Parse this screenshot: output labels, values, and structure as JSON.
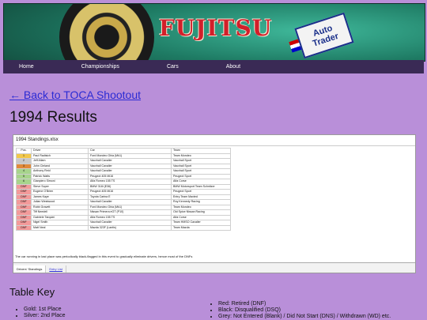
{
  "banner": {
    "brand": "FUJITSU",
    "sponsor_line1": "Auto",
    "sponsor_line2": "Trader"
  },
  "nav": {
    "items": [
      "Home",
      "Championships",
      "Cars",
      "About"
    ]
  },
  "back_link": "← Back to TOCA Shootout",
  "page_title": "1994 Results",
  "sheet": {
    "filename": "1994 Standings.xlsx",
    "headers": [
      "Pos.",
      "Driver",
      "Car",
      "Team"
    ],
    "rows": [
      {
        "pos": "1",
        "driver": "Paul Radisich",
        "car": "Ford Mondeo Ghia (Mk1)",
        "team": "Team Mondeo",
        "cls": "gold"
      },
      {
        "pos": "2",
        "driver": "Jeff Allam",
        "car": "Vauxhall Cavalier",
        "team": "Vauxhall Sport",
        "cls": "silver"
      },
      {
        "pos": "3",
        "driver": "John Cleland",
        "car": "Vauxhall Cavalier",
        "team": "Vauxhall Sport",
        "cls": "bronze"
      },
      {
        "pos": "4",
        "driver": "Anthony Reid",
        "car": "Vauxhall Cavalier",
        "team": "Vauxhall Sport",
        "cls": "green"
      },
      {
        "pos": "5",
        "driver": "Patrick Watts",
        "car": "Peugeot 405 Mi16",
        "team": "Peugeot Sport",
        "cls": "green"
      },
      {
        "pos": "6",
        "driver": "Gianpiero Simoni",
        "car": "Alfa Romeo 155 TS",
        "team": "Alfa Corse",
        "cls": "green"
      },
      {
        "pos": "DNF",
        "driver": "Steve Soper",
        "car": "BMW 318i (E36)",
        "team": "BMW Motorsport Team Schnitzer",
        "cls": "red"
      },
      {
        "pos": "DNF",
        "driver": "Eugene O'Brien",
        "car": "Peugeot 405 Mi16",
        "team": "Peugeot Sport",
        "cls": "red"
      },
      {
        "pos": "DNF",
        "driver": "James Kaye",
        "car": "Toyota Carina E",
        "team": "Entry Team Maxted",
        "cls": "red"
      },
      {
        "pos": "DNF",
        "driver": "Julian Westwood",
        "car": "Vauxhall Cavalier",
        "team": "Roy Kennedy Racing",
        "cls": "red"
      },
      {
        "pos": "DNF",
        "driver": "Robb Gravett",
        "car": "Ford Mondeo Ghia (Mk1)",
        "team": "Team Mondeo",
        "cls": "red"
      },
      {
        "pos": "DNF",
        "driver": "Tiff Needell",
        "car": "Nissan Primera eGT (P10)",
        "team": "Old Spice Nissan Racing",
        "cls": "red"
      },
      {
        "pos": "DNF",
        "driver": "Gabriele Tarquini",
        "car": "Alfa Romeo 155 TS",
        "team": "Alfa Corse",
        "cls": "red"
      },
      {
        "pos": "DNF",
        "driver": "Nigel Smith",
        "car": "Vauxhall Cavalier",
        "team": "Team HMSO Cavalier",
        "cls": "red"
      },
      {
        "pos": "DNF",
        "driver": "Matt Neal",
        "car": "Mazda 323F (Lantis)",
        "team": "Team Mazda",
        "cls": "red"
      }
    ],
    "note": "The car running in last place was periodically black-flagged in this event to gradually eliminate drivers, hence most of the DNFs",
    "tabs": {
      "active": "Drivers' Standings",
      "other": "Entry List"
    }
  },
  "key": {
    "title": "Table Key",
    "left": [
      "Gold: 1st Place",
      "Silver: 2nd Place"
    ],
    "right": [
      "Red: Retired (DNF)",
      "Black: Disqualified (DSQ)",
      "Grey: Not Entered (Blank) / Did Not Start (DNS) / Withdrawn (WD) etc."
    ]
  }
}
